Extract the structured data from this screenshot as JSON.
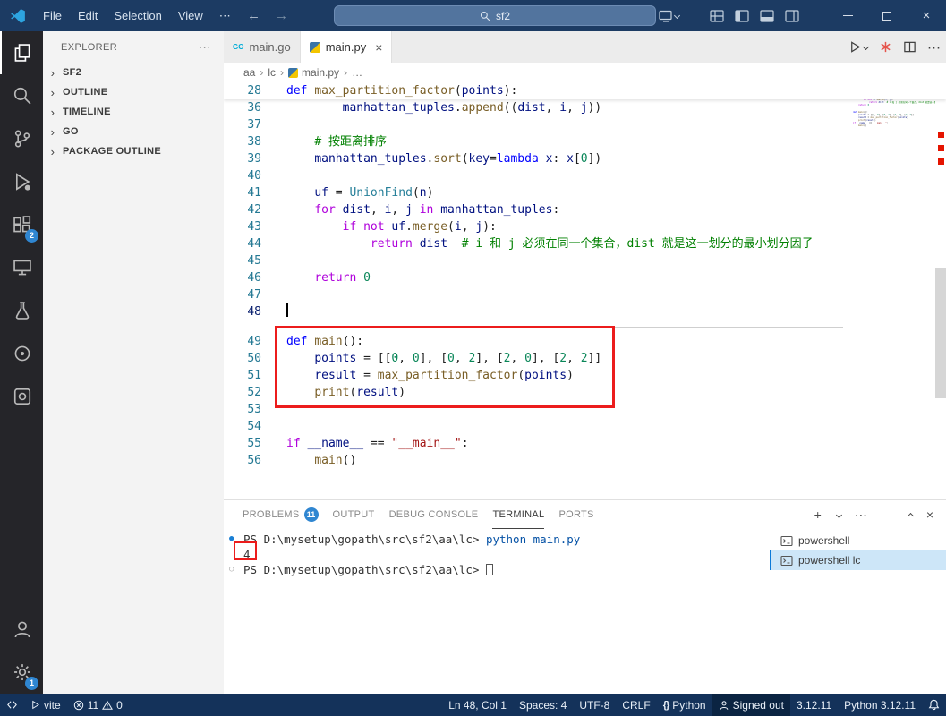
{
  "icons": {
    "more-horizontal": "⋯",
    "back-arrow": "←",
    "forward-arrow": "→",
    "chevron-right": "›",
    "close": "×",
    "plus": "+",
    "go-logo": "GO",
    "braces": "{}",
    "filled-circle": "●",
    "open-circle": "○",
    "ellipsis": "…"
  },
  "titlebar": {
    "menus": [
      "File",
      "Edit",
      "Selection",
      "View"
    ],
    "search": {
      "value": "sf2"
    }
  },
  "activity_bar": {
    "extensions_badge": "2",
    "settings_badge": "1"
  },
  "sidebar": {
    "title": "EXPLORER",
    "sections": [
      {
        "label": "SF2"
      },
      {
        "label": "OUTLINE"
      },
      {
        "label": "TIMELINE"
      },
      {
        "label": "GO"
      },
      {
        "label": "PACKAGE OUTLINE"
      }
    ]
  },
  "editor": {
    "tabs": [
      {
        "label": "main.go",
        "icon": "go",
        "active": false
      },
      {
        "label": "main.py",
        "icon": "python",
        "active": true
      }
    ],
    "breadcrumb": [
      {
        "label": "aa"
      },
      {
        "label": "lc"
      },
      {
        "label": "main.py",
        "icon": "python"
      },
      {
        "label": "…"
      }
    ],
    "sticky": {
      "n": "28",
      "seg": [
        [
          "kw",
          "def "
        ],
        [
          "fn",
          "max_partition_factor"
        ],
        [
          "pl",
          "("
        ],
        [
          "var",
          "points"
        ],
        [
          "pl",
          "):"
        ]
      ]
    },
    "lines": [
      {
        "n": "36",
        "seg": [
          [
            "pl",
            "        "
          ],
          [
            "var",
            "manhattan_tuples"
          ],
          [
            "pl",
            "."
          ],
          [
            "fn",
            "append"
          ],
          [
            "pl",
            "(("
          ],
          [
            "var",
            "dist"
          ],
          [
            "pl",
            ", "
          ],
          [
            "var",
            "i"
          ],
          [
            "pl",
            ", "
          ],
          [
            "var",
            "j"
          ],
          [
            "pl",
            "))"
          ]
        ]
      },
      {
        "n": "37",
        "seg": []
      },
      {
        "n": "38",
        "seg": [
          [
            "pl",
            "    "
          ],
          [
            "com",
            "# 按距离排序"
          ]
        ]
      },
      {
        "n": "39",
        "seg": [
          [
            "pl",
            "    "
          ],
          [
            "var",
            "manhattan_tuples"
          ],
          [
            "pl",
            "."
          ],
          [
            "fn",
            "sort"
          ],
          [
            "pl",
            "("
          ],
          [
            "var",
            "key"
          ],
          [
            "pl",
            "="
          ],
          [
            "kw",
            "lambda"
          ],
          [
            "pl",
            " "
          ],
          [
            "var",
            "x"
          ],
          [
            "pl",
            ": "
          ],
          [
            "var",
            "x"
          ],
          [
            "pl",
            "["
          ],
          [
            "num",
            "0"
          ],
          [
            "pl",
            "])"
          ]
        ]
      },
      {
        "n": "40",
        "seg": []
      },
      {
        "n": "41",
        "seg": [
          [
            "pl",
            "    "
          ],
          [
            "var",
            "uf"
          ],
          [
            "pl",
            " = "
          ],
          [
            "cls",
            "UnionFind"
          ],
          [
            "pl",
            "("
          ],
          [
            "var",
            "n"
          ],
          [
            "pl",
            ")"
          ]
        ]
      },
      {
        "n": "42",
        "seg": [
          [
            "pl",
            "    "
          ],
          [
            "ctl",
            "for"
          ],
          [
            "pl",
            " "
          ],
          [
            "var",
            "dist"
          ],
          [
            "pl",
            ", "
          ],
          [
            "var",
            "i"
          ],
          [
            "pl",
            ", "
          ],
          [
            "var",
            "j"
          ],
          [
            "pl",
            " "
          ],
          [
            "ctl",
            "in"
          ],
          [
            "pl",
            " "
          ],
          [
            "var",
            "manhattan_tuples"
          ],
          [
            "pl",
            ":"
          ]
        ]
      },
      {
        "n": "43",
        "seg": [
          [
            "pl",
            "        "
          ],
          [
            "ctl",
            "if"
          ],
          [
            "pl",
            " "
          ],
          [
            "ctl",
            "not"
          ],
          [
            "pl",
            " "
          ],
          [
            "var",
            "uf"
          ],
          [
            "pl",
            "."
          ],
          [
            "fn",
            "merge"
          ],
          [
            "pl",
            "("
          ],
          [
            "var",
            "i"
          ],
          [
            "pl",
            ", "
          ],
          [
            "var",
            "j"
          ],
          [
            "pl",
            "):"
          ]
        ]
      },
      {
        "n": "44",
        "seg": [
          [
            "pl",
            "            "
          ],
          [
            "ctl",
            "return"
          ],
          [
            "pl",
            " "
          ],
          [
            "var",
            "dist"
          ],
          [
            "pl",
            "  "
          ],
          [
            "com",
            "# i 和 j 必须在同一个集合，dist 就是这一划分的最小划分因子"
          ]
        ]
      },
      {
        "n": "45",
        "seg": []
      },
      {
        "n": "46",
        "seg": [
          [
            "pl",
            "    "
          ],
          [
            "ctl",
            "return"
          ],
          [
            "pl",
            " "
          ],
          [
            "num",
            "0"
          ]
        ]
      },
      {
        "n": "47",
        "seg": []
      },
      {
        "n": "48",
        "seg": [],
        "cursor": true
      },
      {
        "n": "49",
        "seg": [
          [
            "kw",
            "def "
          ],
          [
            "fn",
            "main"
          ],
          [
            "pl",
            "():"
          ]
        ],
        "section_break": true
      },
      {
        "n": "50",
        "seg": [
          [
            "pl",
            "    "
          ],
          [
            "var",
            "points"
          ],
          [
            "pl",
            " = [["
          ],
          [
            "num",
            "0"
          ],
          [
            "pl",
            ", "
          ],
          [
            "num",
            "0"
          ],
          [
            "pl",
            "], ["
          ],
          [
            "num",
            "0"
          ],
          [
            "pl",
            ", "
          ],
          [
            "num",
            "2"
          ],
          [
            "pl",
            "], ["
          ],
          [
            "num",
            "2"
          ],
          [
            "pl",
            ", "
          ],
          [
            "num",
            "0"
          ],
          [
            "pl",
            "], ["
          ],
          [
            "num",
            "2"
          ],
          [
            "pl",
            ", "
          ],
          [
            "num",
            "2"
          ],
          [
            "pl",
            "]]"
          ]
        ]
      },
      {
        "n": "51",
        "seg": [
          [
            "pl",
            "    "
          ],
          [
            "var",
            "result"
          ],
          [
            "pl",
            " = "
          ],
          [
            "fn",
            "max_partition_factor"
          ],
          [
            "pl",
            "("
          ],
          [
            "var",
            "points"
          ],
          [
            "pl",
            ")"
          ]
        ]
      },
      {
        "n": "52",
        "seg": [
          [
            "pl",
            "    "
          ],
          [
            "fn",
            "print"
          ],
          [
            "pl",
            "("
          ],
          [
            "var",
            "result"
          ],
          [
            "pl",
            ")"
          ]
        ]
      },
      {
        "n": "53",
        "seg": []
      },
      {
        "n": "54",
        "seg": []
      },
      {
        "n": "55",
        "seg": [
          [
            "ctl",
            "if"
          ],
          [
            "pl",
            " "
          ],
          [
            "var",
            "__name__"
          ],
          [
            "pl",
            " == "
          ],
          [
            "str",
            "\"__main__\""
          ],
          [
            "pl",
            ":"
          ]
        ]
      },
      {
        "n": "56",
        "seg": [
          [
            "pl",
            "    "
          ],
          [
            "fn",
            "main"
          ],
          [
            "pl",
            "()"
          ]
        ]
      }
    ]
  },
  "panel": {
    "tabs": [
      {
        "label": "PROBLEMS",
        "badge": "11"
      },
      {
        "label": "OUTPUT"
      },
      {
        "label": "DEBUG CONSOLE"
      },
      {
        "label": "TERMINAL",
        "active": true
      },
      {
        "label": "PORTS"
      }
    ],
    "terminal": {
      "lines": [
        {
          "bullet": "filled",
          "seg": [
            [
              "prompt",
              "PS D:\\mysetup\\gopath\\src\\sf2\\aa\\lc> "
            ],
            [
              "cmd",
              "python main.py"
            ]
          ]
        },
        {
          "seg": [
            [
              "out",
              "4"
            ]
          ],
          "annotated": true
        },
        {
          "bullet": "open",
          "seg": [
            [
              "prompt",
              "PS D:\\mysetup\\gopath\\src\\sf2\\aa\\lc> "
            ]
          ],
          "cursor": true
        }
      ]
    },
    "terminal_list": [
      {
        "label": "powershell",
        "selected": false
      },
      {
        "label": "powershell lc",
        "selected": true
      }
    ]
  },
  "statusbar": {
    "left": [
      {
        "icon": "remote",
        "name": "remote-indicator"
      },
      {
        "icon": "play",
        "label": "vite",
        "name": "task-vite"
      },
      {
        "icon": "problems",
        "errors": "11",
        "warnings": "0",
        "name": "problems-summary"
      }
    ],
    "right": [
      {
        "label": "Ln 48, Col 1",
        "name": "cursor-position"
      },
      {
        "label": "Spaces: 4",
        "name": "indentation"
      },
      {
        "label": "UTF-8",
        "name": "encoding"
      },
      {
        "label": "CRLF",
        "name": "end-of-line"
      },
      {
        "icon": "braces",
        "label": "Python",
        "name": "language-mode"
      },
      {
        "icon": "person",
        "label": "Signed out",
        "name": "accounts",
        "emphasis": true
      },
      {
        "label": "3.12.11",
        "name": "python-env-version"
      },
      {
        "label": "Python 3.12.11",
        "name": "python-interpreter"
      },
      {
        "icon": "bell",
        "name": "notifications"
      }
    ]
  },
  "annotations": {
    "color": "#ec1c1c",
    "items": [
      {
        "name": "highlight-main-function"
      },
      {
        "name": "highlight-terminal-output"
      }
    ]
  }
}
